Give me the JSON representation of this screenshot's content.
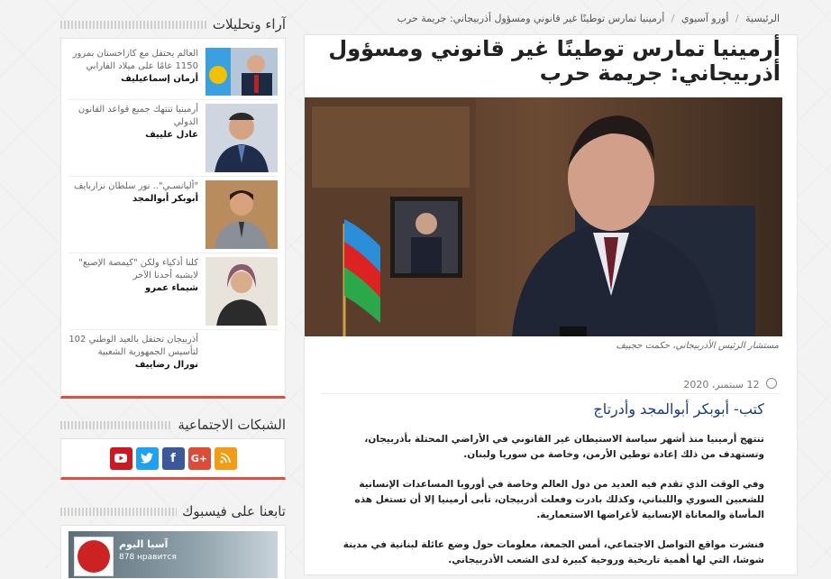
{
  "breadcrumb": {
    "home": "الرئيسية",
    "section": "أورو آسيوي",
    "current": "أرمينيا تمارس توطينًا غير قانوني ومسؤول أذربيجاني: جريمة حرب"
  },
  "article": {
    "title": "أرمينيا تمارس توطينًا غير قانوني ومسؤول أذربيجاني: جريمة حرب",
    "caption": "مستشار الرئيس الأذربيجاني، حكمت حجييف",
    "date": "12 سبتمبر، 2020",
    "author": "كتب- أبوبكر أبوالمجد وأدرتاج",
    "paragraphs": [
      "تنتهج أرمينيا منذ أشهر سياسة الاستيطان غير القانوني في الأراضي المحتلة بأذربيجان، وتستهدف من ذلك إعادة توطين الأرمن، وخاصة من سوريا ولبنان.",
      "وفي الوقت الذي تقدم فيه العديد من دول العالم وخاصة في أوروبا المساعدات الإنسانية للشعبين السوري واللبناني، وكذلك بادرت وفعلت أذربيجان، تأبى أرمينيا إلا أن تستغل هذه المأساة والمعاناة الإنسانية لأغراضها الاستعمارية.",
      "فنشرت مواقع التواصل الاجتماعي، أمس الجمعة، معلومات حول وضع عائلة لبنانية في مدينة شوشا، التي لها أهمية تاريخية وروحية كبيرة لدى الشعب الأذربيجاني."
    ]
  },
  "sidebar": {
    "opinions_title": "آراء وتحليلات",
    "opinions": [
      {
        "text": "العالم يحتفل مع كازاخستان بمرور 1150 عامًا على ميلاد الفارابي",
        "author": "أرمان إسماعيليف"
      },
      {
        "text": "أرمينيا تنتهك جميع قواعد القانون الدولي",
        "author": "عادل علييف"
      },
      {
        "text": "\"أليانسـي\".. نور سلطان نزاربايف",
        "author": "أبوبكر أبوالمجد"
      },
      {
        "text": "كلنا أذكياء ولكن \"كيمصة الإصبع\" لايشبه أحدنا الآخر",
        "author": "شيماء عمرو"
      },
      {
        "text": "أذربيجان تحتفل بالعيد الوطني 102 لتأسيس الجمهورية الشعبية",
        "author": "نورال رضاييف"
      }
    ],
    "social_title": "الشبكات الاجتماعية",
    "social_colors": {
      "youtube": "#cc181e",
      "twitter": "#1da1f2",
      "facebook": "#3b5998",
      "googleplus": "#dd4b39",
      "rss": "#f39c12"
    },
    "facebook_title": "تابعنا على فيسبوك",
    "fb_page_name": "آسيا اليوم",
    "fb_likes": "878 нравится"
  }
}
